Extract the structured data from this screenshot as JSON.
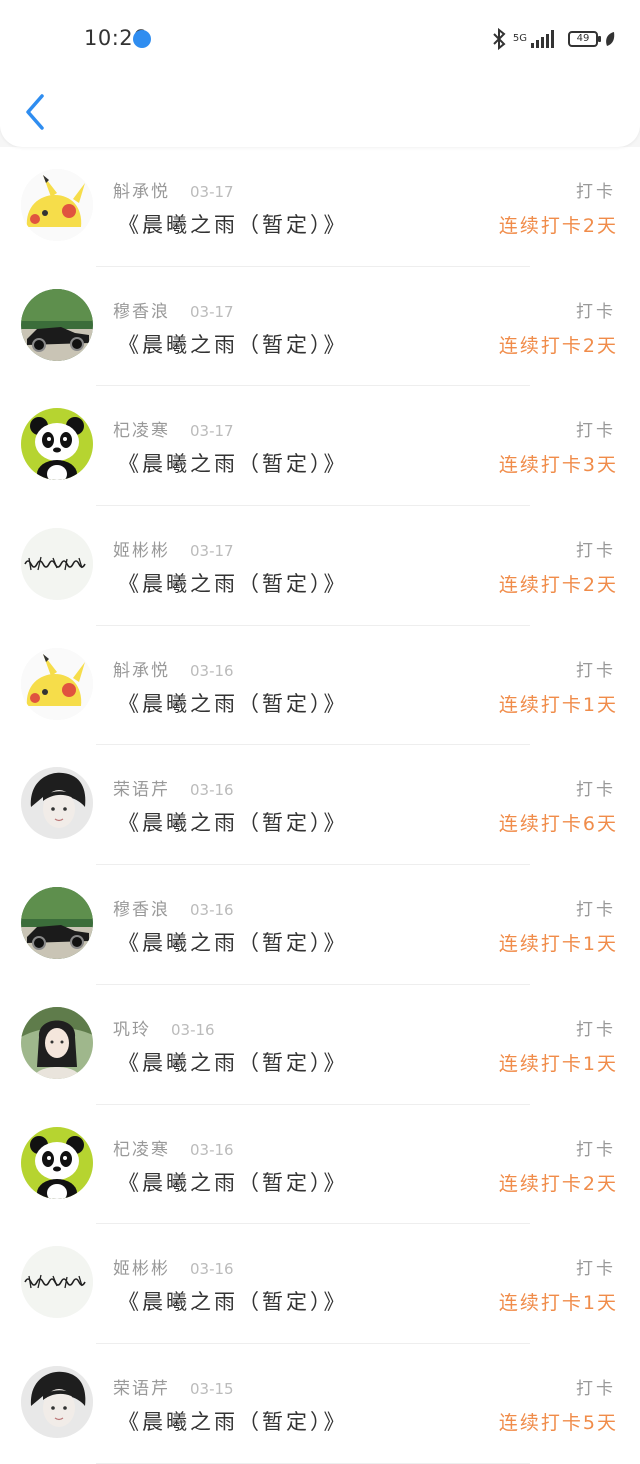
{
  "status": {
    "time": "10:26",
    "network": "5G",
    "battery": "49"
  },
  "colors": {
    "accent": "#2f8df0",
    "streak": "#f08c4a"
  },
  "items": [
    {
      "name": "斛承悦",
      "date": "03-17",
      "title": "《晨曦之雨（暂定）》",
      "action": "打卡",
      "streak": "连续打卡2天",
      "avatar": "pikachu-avatar"
    },
    {
      "name": "穆香浪",
      "date": "03-17",
      "title": "《晨曦之雨（暂定）》",
      "action": "打卡",
      "streak": "连续打卡2天",
      "avatar": "car-avatar"
    },
    {
      "name": "杞凌寒",
      "date": "03-17",
      "title": "《晨曦之雨（暂定）》",
      "action": "打卡",
      "streak": "连续打卡3天",
      "avatar": "panda-avatar"
    },
    {
      "name": "姬彬彬",
      "date": "03-17",
      "title": "《晨曦之雨（暂定）》",
      "action": "打卡",
      "streak": "连续打卡2天",
      "avatar": "calligraphy-avatar"
    },
    {
      "name": "斛承悦",
      "date": "03-16",
      "title": "《晨曦之雨（暂定）》",
      "action": "打卡",
      "streak": "连续打卡1天",
      "avatar": "pikachu-avatar"
    },
    {
      "name": "荣语芹",
      "date": "03-16",
      "title": "《晨曦之雨（暂定）》",
      "action": "打卡",
      "streak": "连续打卡6天",
      "avatar": "boy-avatar"
    },
    {
      "name": "穆香浪",
      "date": "03-16",
      "title": "《晨曦之雨（暂定）》",
      "action": "打卡",
      "streak": "连续打卡1天",
      "avatar": "car-avatar"
    },
    {
      "name": "巩玲",
      "date": "03-16",
      "title": "《晨曦之雨（暂定）》",
      "action": "打卡",
      "streak": "连续打卡1天",
      "avatar": "lady-avatar"
    },
    {
      "name": "杞凌寒",
      "date": "03-16",
      "title": "《晨曦之雨（暂定）》",
      "action": "打卡",
      "streak": "连续打卡2天",
      "avatar": "panda-avatar"
    },
    {
      "name": "姬彬彬",
      "date": "03-16",
      "title": "《晨曦之雨（暂定）》",
      "action": "打卡",
      "streak": "连续打卡1天",
      "avatar": "calligraphy-avatar"
    },
    {
      "name": "荣语芹",
      "date": "03-15",
      "title": "《晨曦之雨（暂定）》",
      "action": "打卡",
      "streak": "连续打卡5天",
      "avatar": "boy-avatar"
    }
  ]
}
